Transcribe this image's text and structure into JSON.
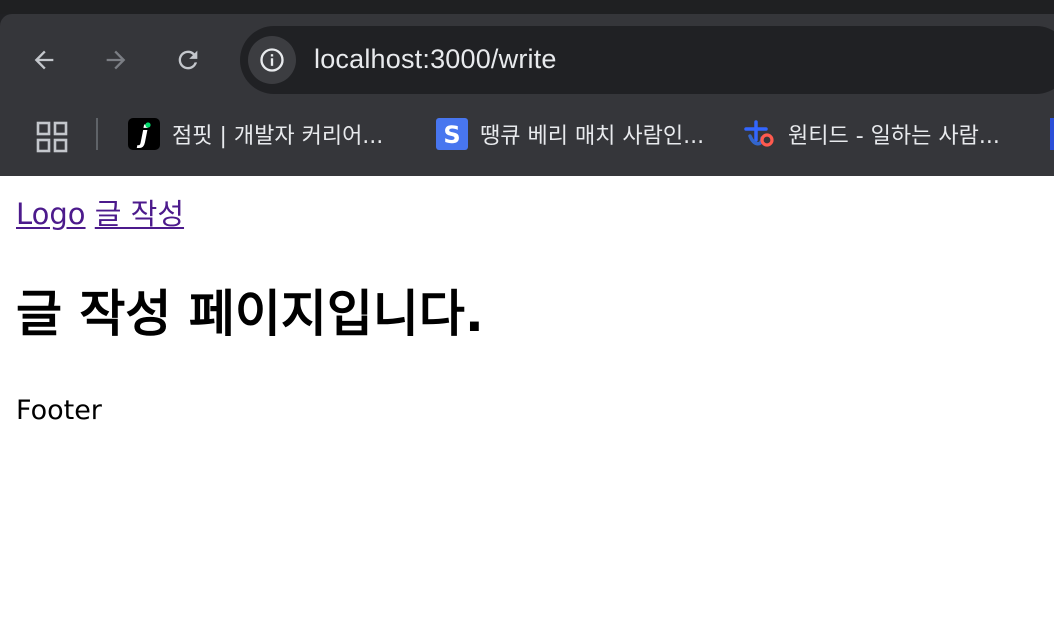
{
  "browser": {
    "url": "localhost:3000/write",
    "bookmarks": [
      {
        "label": "점핏 | 개발자 커리어...",
        "favicon_icon": "jumpit-j-icon",
        "favicon_color": "#000000"
      },
      {
        "label": "땡큐 베리 매치 사람인...",
        "favicon_icon": "saramin-s-icon",
        "favicon_color": "#4876ef"
      },
      {
        "label": "원티드 - 일하는 사람...",
        "favicon_icon": "wanted-logo-icon",
        "favicon_color": "#3366ff"
      }
    ]
  },
  "page": {
    "nav": {
      "logo": "Logo",
      "write": "글 작성"
    },
    "title": "글 작성 페이지입니다.",
    "footer": "Footer"
  },
  "colors": {
    "chrome_bg": "#35363a",
    "omnibox_bg": "#202124",
    "link_visited": "#4c1a8c"
  }
}
